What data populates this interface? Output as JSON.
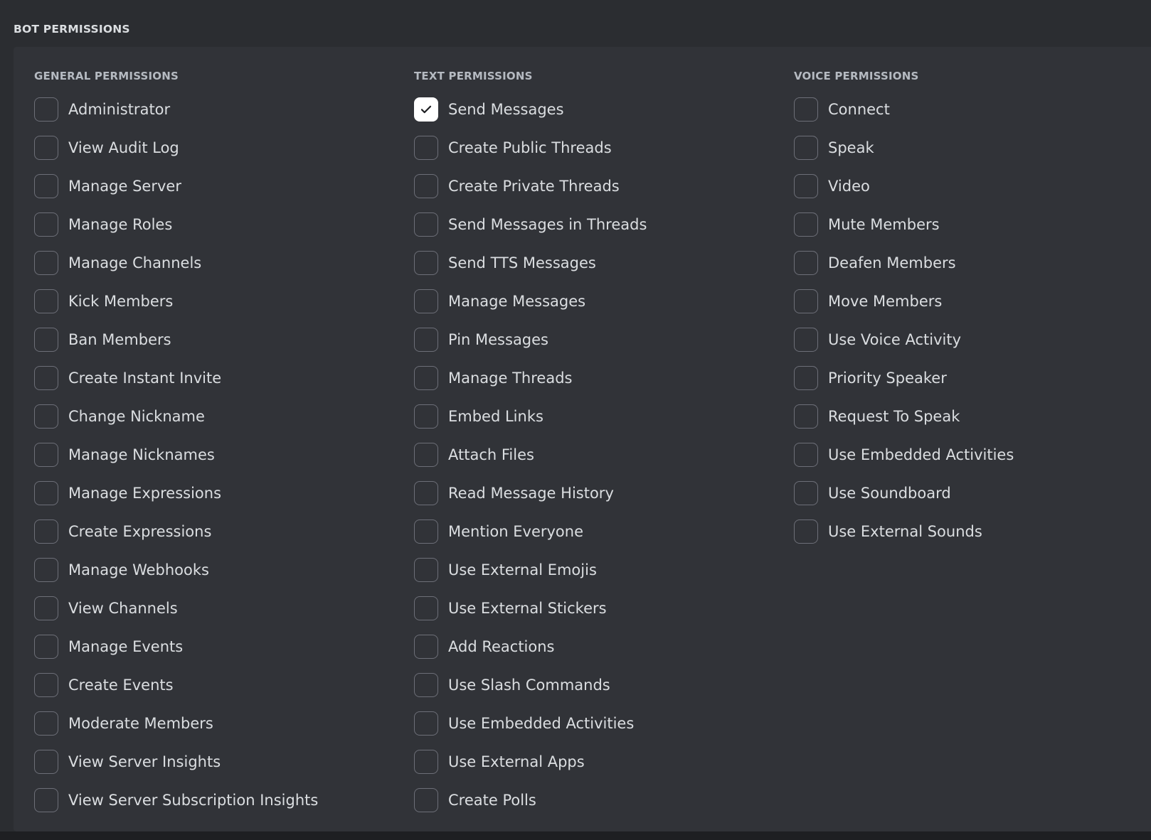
{
  "section": {
    "title": "BOT PERMISSIONS"
  },
  "colors": {
    "background": "#2b2d31",
    "panel": "#313338",
    "text": "#dbdee1",
    "heading": "#b5bac1",
    "checkbox_border": "#6d6f78",
    "checked_fill": "#ffffff"
  },
  "columns": [
    {
      "title": "GENERAL PERMISSIONS",
      "items": [
        {
          "label": "Administrator",
          "checked": false
        },
        {
          "label": "View Audit Log",
          "checked": false
        },
        {
          "label": "Manage Server",
          "checked": false
        },
        {
          "label": "Manage Roles",
          "checked": false
        },
        {
          "label": "Manage Channels",
          "checked": false
        },
        {
          "label": "Kick Members",
          "checked": false
        },
        {
          "label": "Ban Members",
          "checked": false
        },
        {
          "label": "Create Instant Invite",
          "checked": false
        },
        {
          "label": "Change Nickname",
          "checked": false
        },
        {
          "label": "Manage Nicknames",
          "checked": false
        },
        {
          "label": "Manage Expressions",
          "checked": false
        },
        {
          "label": "Create Expressions",
          "checked": false
        },
        {
          "label": "Manage Webhooks",
          "checked": false
        },
        {
          "label": "View Channels",
          "checked": false
        },
        {
          "label": "Manage Events",
          "checked": false
        },
        {
          "label": "Create Events",
          "checked": false
        },
        {
          "label": "Moderate Members",
          "checked": false
        },
        {
          "label": "View Server Insights",
          "checked": false
        },
        {
          "label": "View Server Subscription Insights",
          "checked": false
        }
      ]
    },
    {
      "title": "TEXT PERMISSIONS",
      "items": [
        {
          "label": "Send Messages",
          "checked": true
        },
        {
          "label": "Create Public Threads",
          "checked": false
        },
        {
          "label": "Create Private Threads",
          "checked": false
        },
        {
          "label": "Send Messages in Threads",
          "checked": false
        },
        {
          "label": "Send TTS Messages",
          "checked": false
        },
        {
          "label": "Manage Messages",
          "checked": false
        },
        {
          "label": "Pin Messages",
          "checked": false
        },
        {
          "label": "Manage Threads",
          "checked": false
        },
        {
          "label": "Embed Links",
          "checked": false
        },
        {
          "label": "Attach Files",
          "checked": false
        },
        {
          "label": "Read Message History",
          "checked": false
        },
        {
          "label": "Mention Everyone",
          "checked": false
        },
        {
          "label": "Use External Emojis",
          "checked": false
        },
        {
          "label": "Use External Stickers",
          "checked": false
        },
        {
          "label": "Add Reactions",
          "checked": false
        },
        {
          "label": "Use Slash Commands",
          "checked": false
        },
        {
          "label": "Use Embedded Activities",
          "checked": false
        },
        {
          "label": "Use External Apps",
          "checked": false
        },
        {
          "label": "Create Polls",
          "checked": false
        }
      ]
    },
    {
      "title": "VOICE PERMISSIONS",
      "items": [
        {
          "label": "Connect",
          "checked": false
        },
        {
          "label": "Speak",
          "checked": false
        },
        {
          "label": "Video",
          "checked": false
        },
        {
          "label": "Mute Members",
          "checked": false
        },
        {
          "label": "Deafen Members",
          "checked": false
        },
        {
          "label": "Move Members",
          "checked": false
        },
        {
          "label": "Use Voice Activity",
          "checked": false
        },
        {
          "label": "Priority Speaker",
          "checked": false
        },
        {
          "label": "Request To Speak",
          "checked": false
        },
        {
          "label": "Use Embedded Activities",
          "checked": false
        },
        {
          "label": "Use Soundboard",
          "checked": false
        },
        {
          "label": "Use External Sounds",
          "checked": false
        }
      ]
    }
  ]
}
